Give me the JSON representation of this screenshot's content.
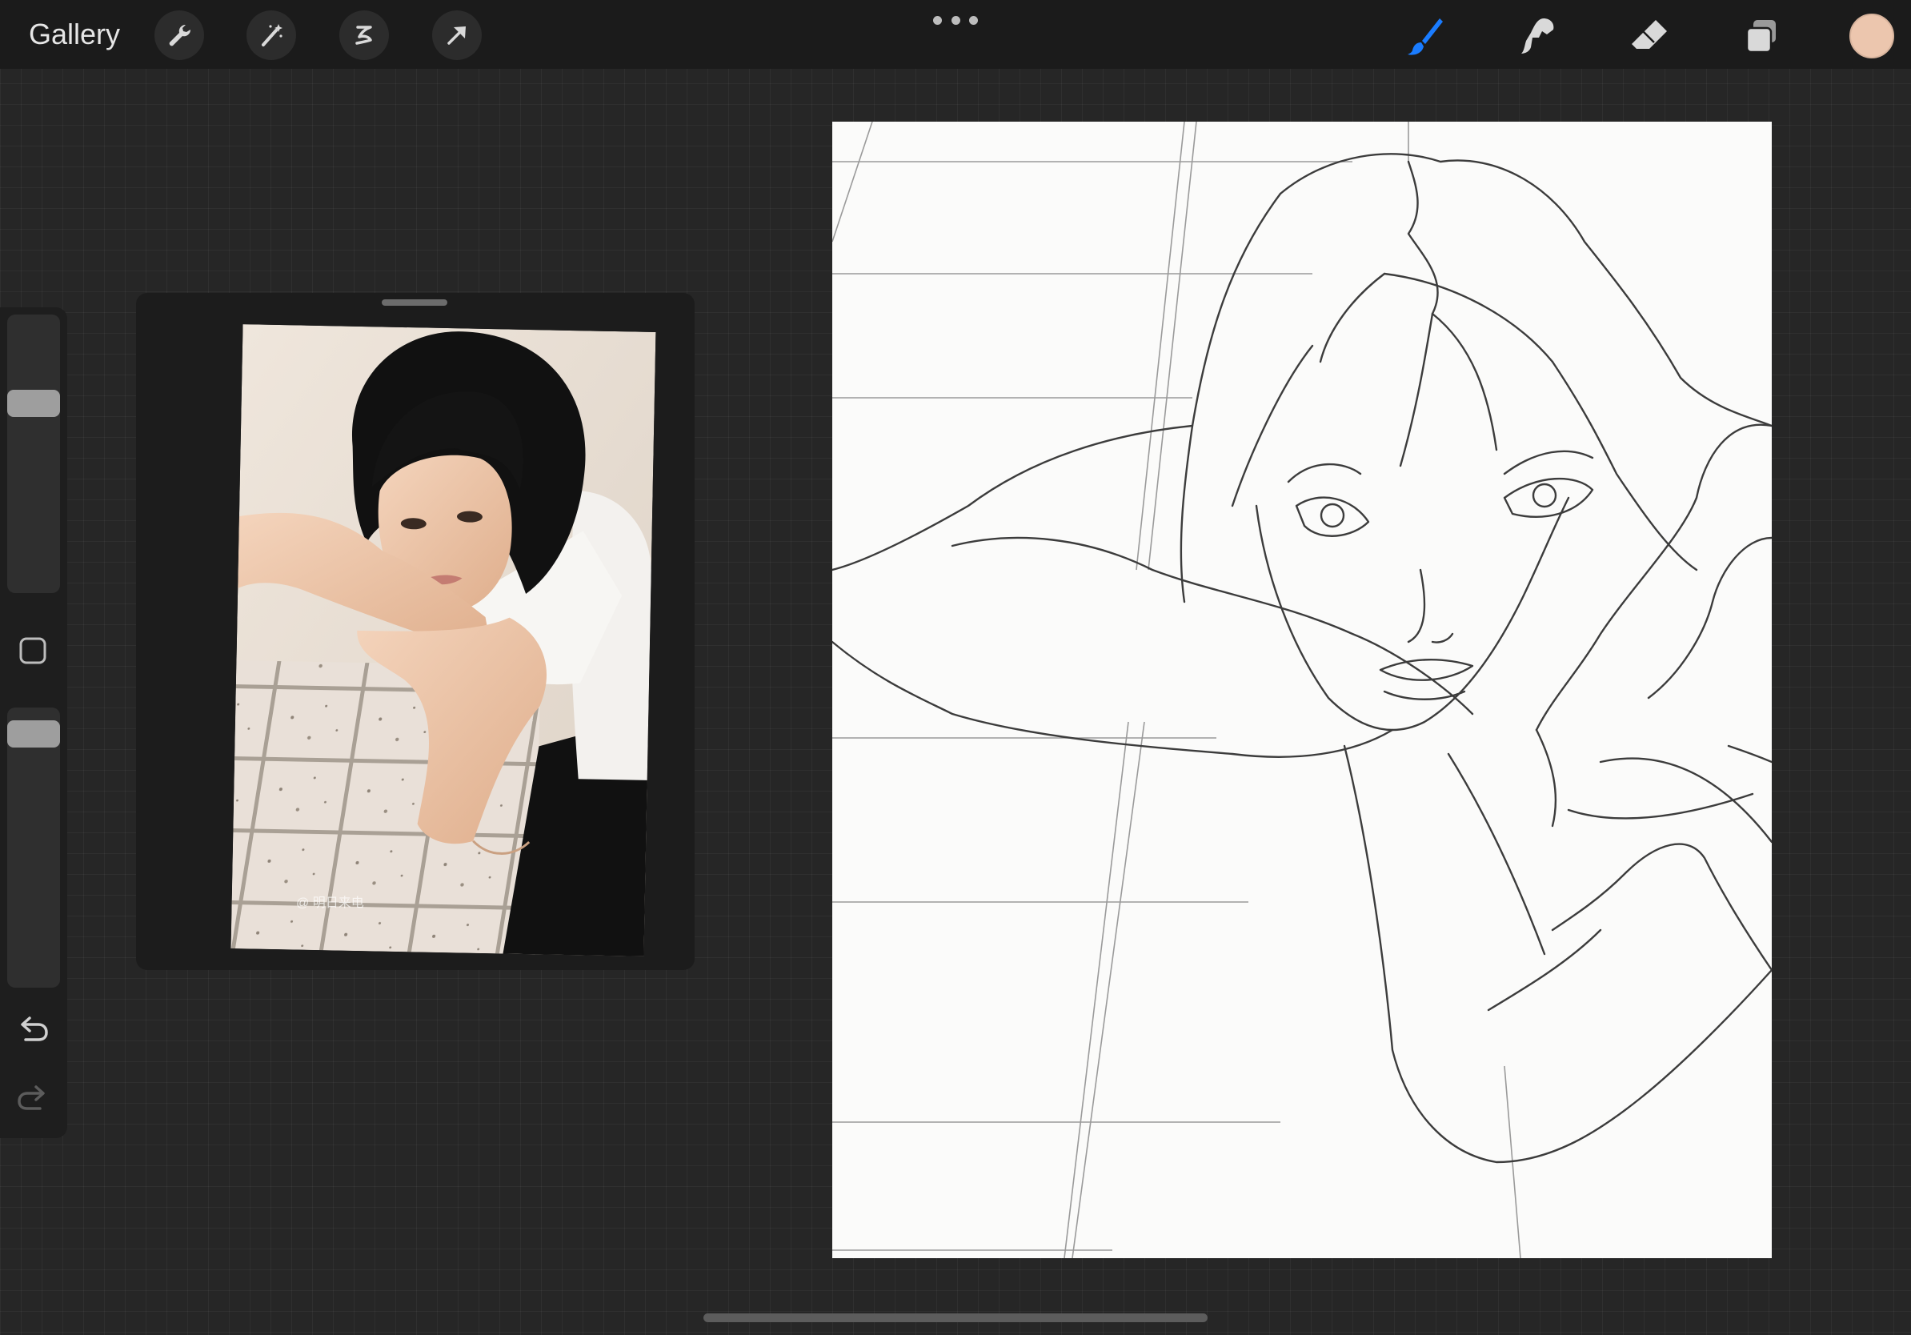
{
  "app": {
    "gallery_label": "Gallery"
  },
  "toolbar": {
    "left_tools": [
      "wrench-icon",
      "magic-wand-icon",
      "selection-icon",
      "transform-arrow-icon"
    ],
    "right_tools": [
      "brush-icon",
      "smudge-icon",
      "eraser-icon",
      "layers-icon"
    ],
    "active_tool": "brush-icon",
    "active_color": "#ecc6ae",
    "accent_color": "#1a7cff"
  },
  "sidebar": {
    "brush_size_fraction": 0.7,
    "opacity_fraction": 0.95
  },
  "reference": {
    "watermark": "@ 明日来电"
  }
}
